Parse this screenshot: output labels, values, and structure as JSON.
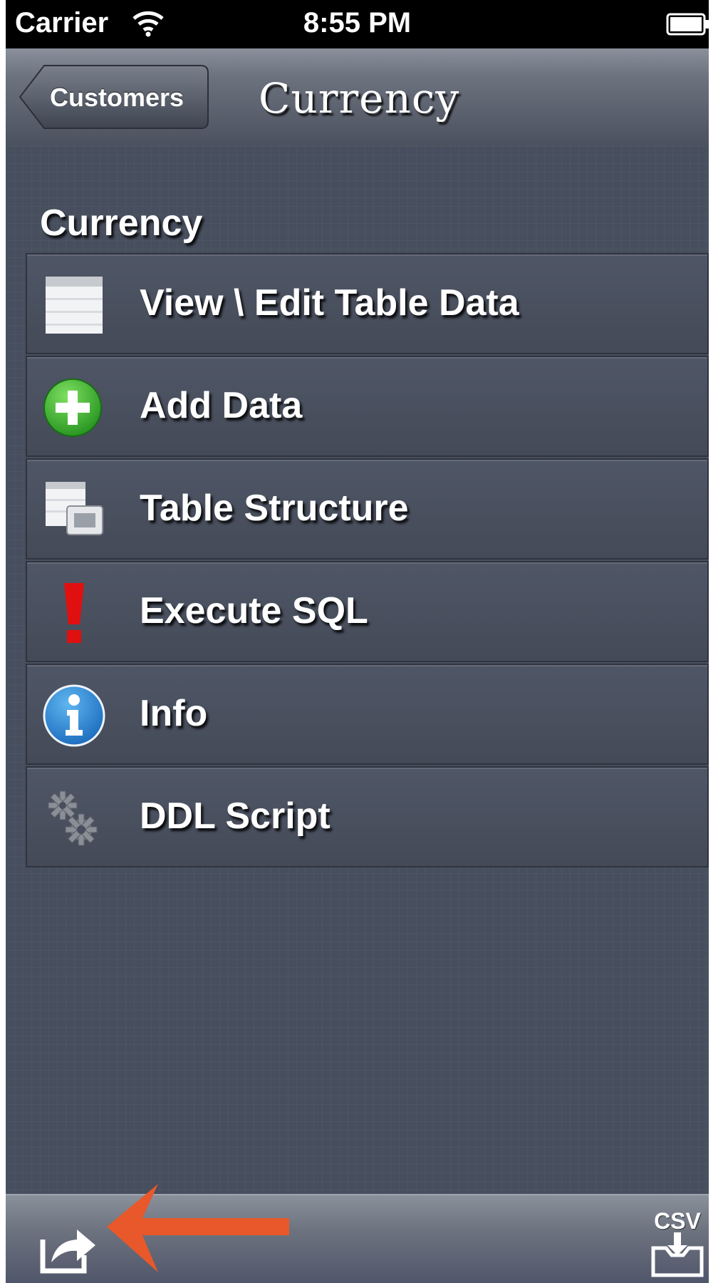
{
  "status_bar": {
    "carrier": "Carrier",
    "time": "8:55 PM"
  },
  "nav_bar": {
    "back_label": "Customers",
    "title": "Currency"
  },
  "section_title": "Currency",
  "menu_items": [
    {
      "label": "View \\ Edit Table Data",
      "icon": "table-icon"
    },
    {
      "label": "Add Data",
      "icon": "add-circle-icon"
    },
    {
      "label": "Table Structure",
      "icon": "table-structure-icon"
    },
    {
      "label": "Execute SQL",
      "icon": "exclamation-icon"
    },
    {
      "label": "Info",
      "icon": "info-icon"
    },
    {
      "label": "DDL Script",
      "icon": "gears-icon"
    }
  ],
  "toolbar": {
    "share_icon": "share-icon",
    "csv_label": "CSV",
    "annotation_color": "#e8582b"
  },
  "colors": {
    "background": "#474e5d",
    "accent_red": "#e8582b"
  }
}
